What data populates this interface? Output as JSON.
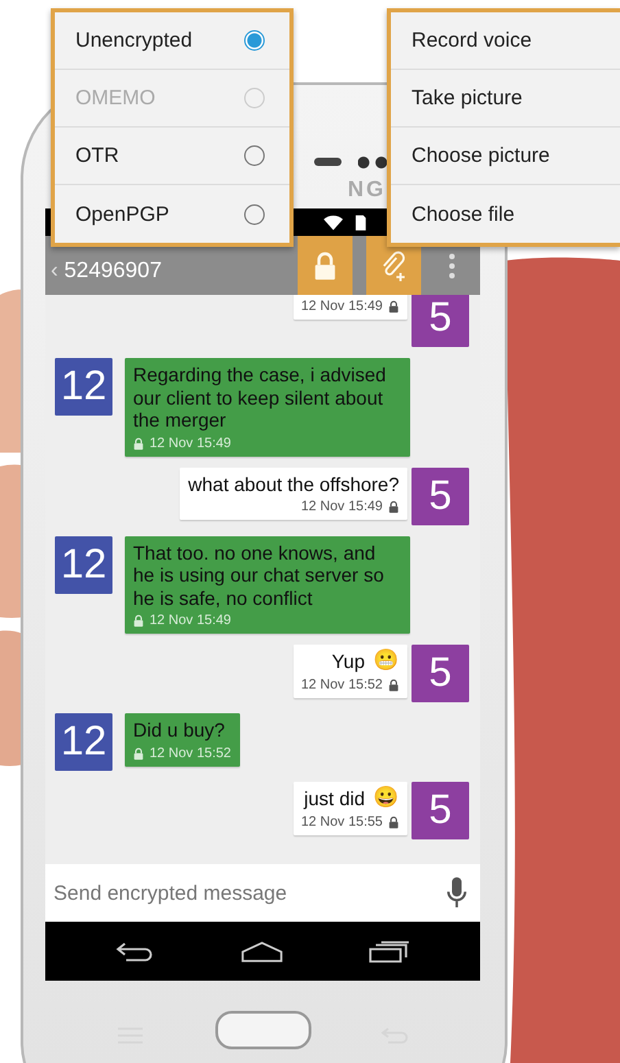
{
  "phone": {
    "brand": "NG"
  },
  "toolbar": {
    "back": "‹",
    "title": "52496907"
  },
  "encryption_menu": [
    {
      "label": "Unencrypted",
      "selected": true,
      "disabled": false
    },
    {
      "label": "OMEMO",
      "selected": false,
      "disabled": true
    },
    {
      "label": "OTR",
      "selected": false,
      "disabled": false
    },
    {
      "label": "OpenPGP",
      "selected": false,
      "disabled": false
    }
  ],
  "attach_menu": [
    "Record voice",
    "Take picture",
    "Choose picture",
    "Choose file"
  ],
  "messages": [
    {
      "kind": "sent",
      "avatar": "5",
      "time": "12 Nov 15:49"
    },
    {
      "kind": "received",
      "avatar": "12",
      "text": "Regarding the case, i advised our client to keep silent about the merger",
      "time": "12 Nov 15:49"
    },
    {
      "kind": "sent",
      "avatar": "5",
      "text": "what about the offshore?",
      "time": "12 Nov 15:49"
    },
    {
      "kind": "received",
      "avatar": "12",
      "text": "That too. no one knows, and he is using our chat server so he is safe, no conflict",
      "time": "12 Nov 15:49"
    },
    {
      "kind": "sent",
      "avatar": "5",
      "text": "Yup",
      "emoji": "😬",
      "time": "12 Nov 15:52"
    },
    {
      "kind": "received",
      "avatar": "12",
      "text": "Did u buy?",
      "time": "12 Nov 15:52"
    },
    {
      "kind": "sent",
      "avatar": "5",
      "text": "just did",
      "emoji": "😀",
      "time": "12 Nov 15:55"
    }
  ],
  "composer": {
    "placeholder": "Send encrypted message"
  }
}
